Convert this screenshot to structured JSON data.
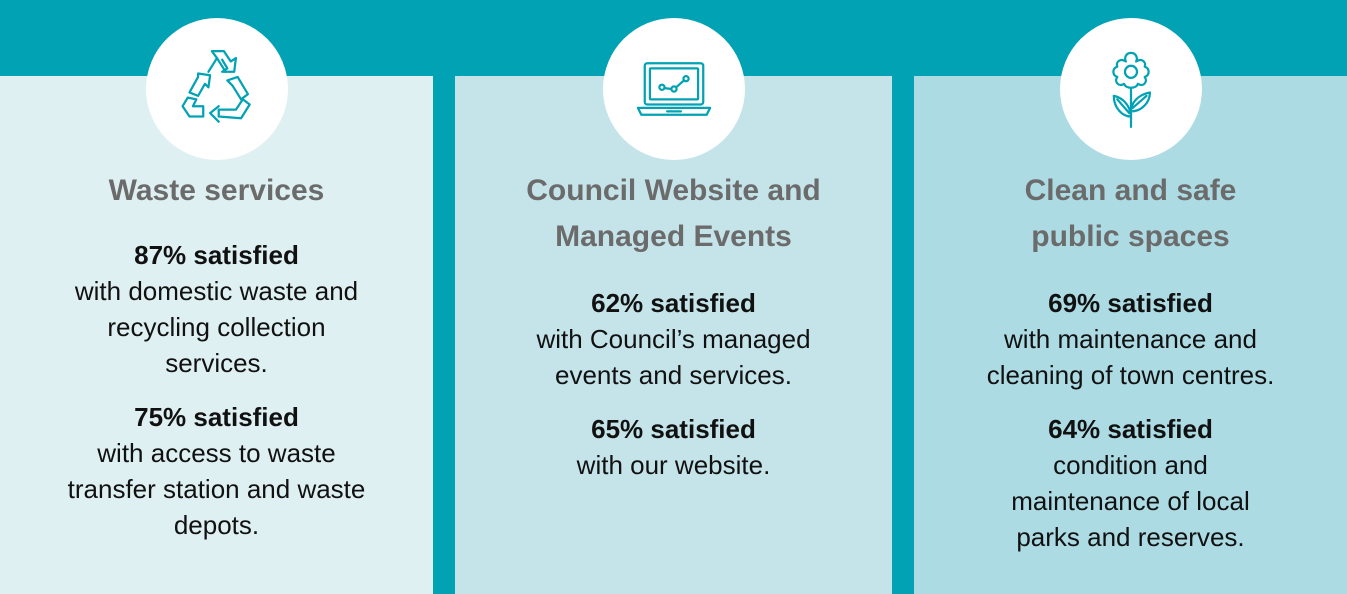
{
  "colors": {
    "background": "#00a2b4",
    "panel_1": "#dff0f3",
    "panel_2": "#c5e4ea",
    "panel_3": "#acdbe3",
    "icon_stroke": "#00a2b4",
    "title_text": "#6b6b6b",
    "body_text": "#111111"
  },
  "panels": [
    {
      "icon": "recycle-icon",
      "title": "Waste services",
      "stats": [
        {
          "head": "87% satisfied",
          "body": "with domestic waste and recycling collection services."
        },
        {
          "head": "75% satisfied",
          "body": "with access to waste transfer station and waste depots."
        }
      ]
    },
    {
      "icon": "laptop-chart-icon",
      "title": "Council Website and Managed Events",
      "stats": [
        {
          "head": "62% satisfied",
          "body": "with Council’s managed events and services."
        },
        {
          "head": "65% satisfied",
          "body": "with our website."
        }
      ]
    },
    {
      "icon": "flower-icon",
      "title": "Clean and safe public spaces",
      "stats": [
        {
          "head": "69% satisfied",
          "body": "with maintenance and cleaning of town centres."
        },
        {
          "head": "64% satisfied",
          "body": "condition and maintenance of local parks and reserves."
        }
      ]
    }
  ]
}
